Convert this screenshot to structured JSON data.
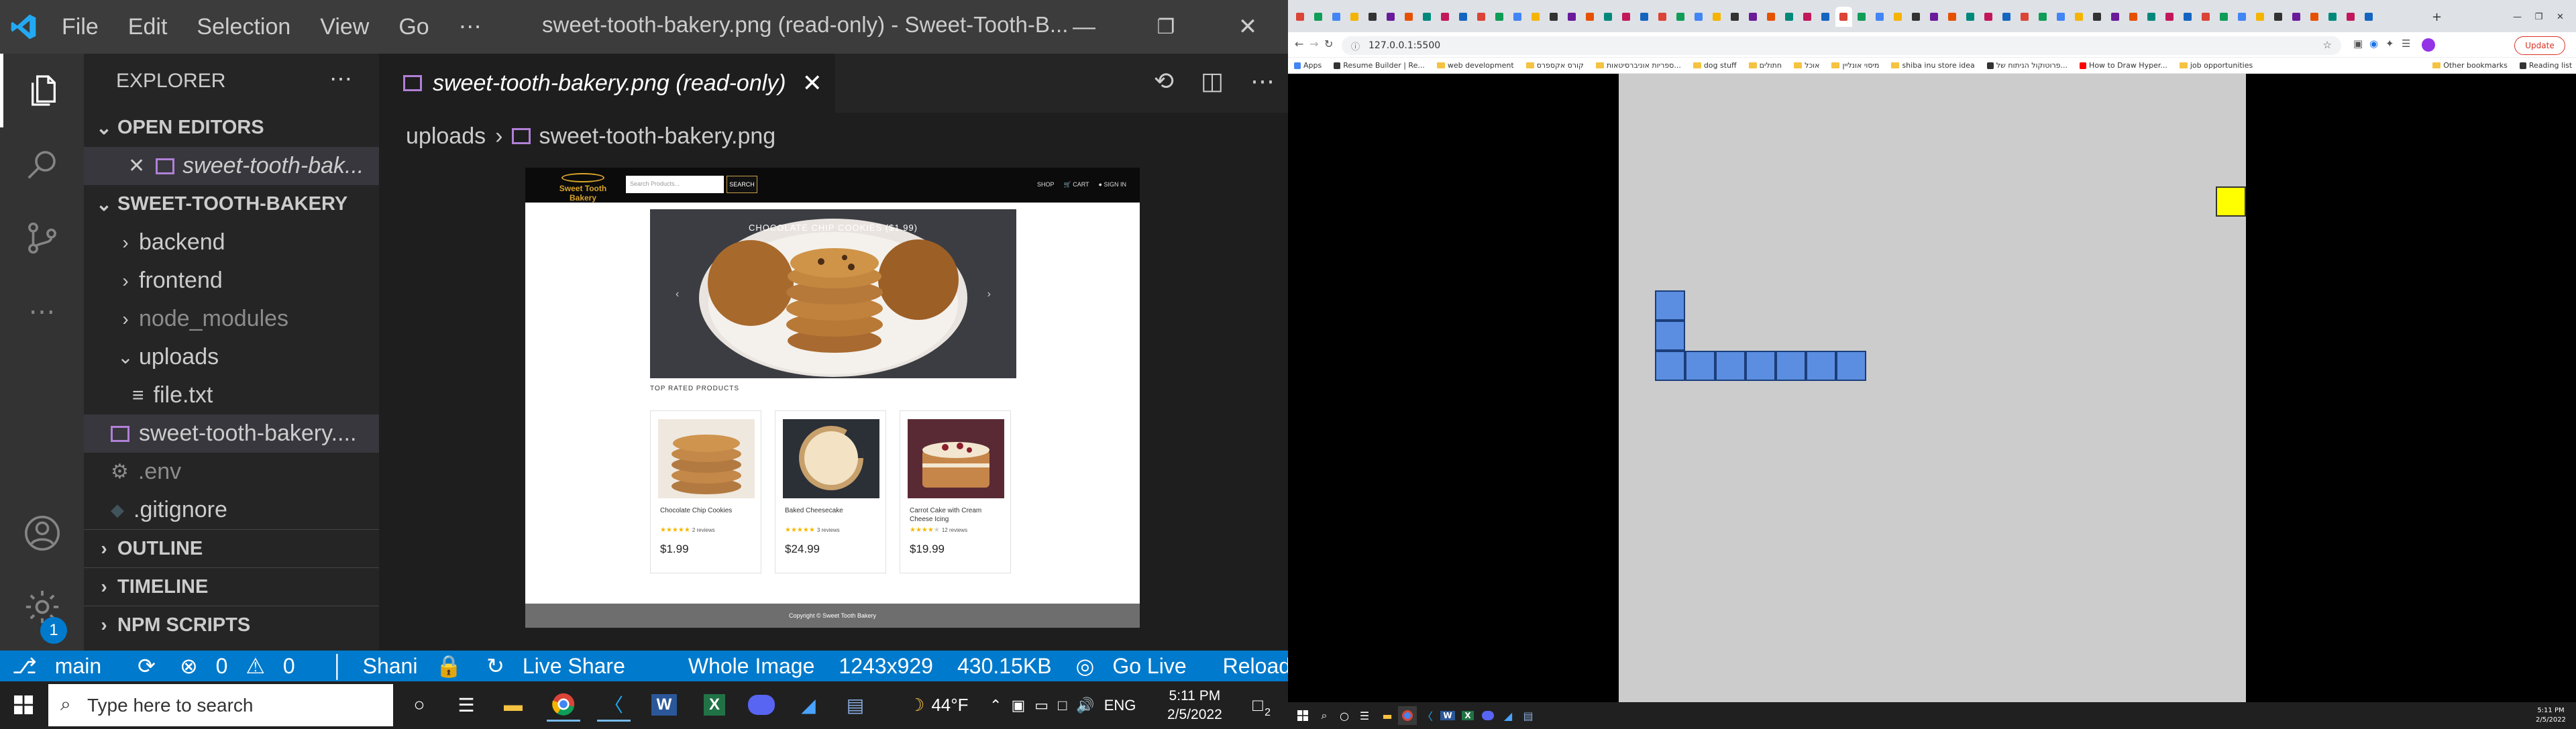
{
  "vscode": {
    "menu": [
      "File",
      "Edit",
      "Selection",
      "View",
      "Go",
      "⋯"
    ],
    "window_title": "sweet-tooth-bakery.png (read-only) - Sweet-Tooth-B...",
    "sidebar": {
      "title": "EXPLORER",
      "open_editors_label": "OPEN EDITORS",
      "open_editor_item": "sweet-tooth-bak...",
      "project_label": "SWEET-TOOTH-BAKERY",
      "items": [
        {
          "label": "backend",
          "kind": "folder"
        },
        {
          "label": "frontend",
          "kind": "folder"
        },
        {
          "label": "node_modules",
          "kind": "folder"
        },
        {
          "label": "uploads",
          "kind": "folder-open"
        },
        {
          "label": "file.txt",
          "kind": "file"
        },
        {
          "label": "sweet-tooth-bakery....",
          "kind": "image"
        },
        {
          "label": ".env",
          "kind": "gear"
        },
        {
          "label": ".gitignore",
          "kind": "diamond"
        }
      ],
      "outline_label": "OUTLINE",
      "timeline_label": "TIMELINE",
      "npm_label": "NPM SCRIPTS"
    },
    "tab": {
      "label": "sweet-tooth-bakery.png (read-only)"
    },
    "breadcrumb": {
      "folder": "uploads",
      "file": "sweet-tooth-bakery.png"
    },
    "settings_badge": "1",
    "statusbar": {
      "branch": "main",
      "errors": "0",
      "warnings": "0",
      "user": "Shani",
      "live_share": "Live Share",
      "zoom": "Whole Image",
      "dimensions": "1243x929",
      "size": "430.15KB",
      "go_live": "Go Live",
      "reload": "Reload"
    }
  },
  "preview": {
    "logo_text": "Sweet Tooth Bakery",
    "search_placeholder": "Search Products...",
    "search_button": "SEARCH",
    "nav_shop": "SHOP",
    "nav_cart": "CART",
    "nav_signin": "SIGN IN",
    "hero_title": "CHOCOLATE CHIP COOKIES ($1.99)",
    "section_title": "TOP RATED PRODUCTS",
    "products": [
      {
        "name": "Chocolate Chip Cookies",
        "rating": 5,
        "reviews": "2 reviews",
        "price": "$1.99"
      },
      {
        "name": "Baked Cheesecake",
        "rating": 5,
        "reviews": "3 reviews",
        "price": "$24.99"
      },
      {
        "name": "Carrot Cake with Cream Cheese Icing",
        "rating": 4,
        "reviews": "12 reviews",
        "price": "$19.99"
      }
    ],
    "footer": "Copyright © Sweet Tooth Bakery"
  },
  "chrome": {
    "url": "127.0.0.1:5500",
    "update_label": "Update",
    "bookmarks": [
      {
        "label": "Apps",
        "kind": "apps"
      },
      {
        "label": "Resume Builder | Re...",
        "kind": "site"
      },
      {
        "label": "web development",
        "kind": "folder"
      },
      {
        "label": "קורס אקספרס",
        "kind": "folder"
      },
      {
        "label": "ספריות אוניברסיטאות...",
        "kind": "folder"
      },
      {
        "label": "dog stuff",
        "kind": "folder"
      },
      {
        "label": "חתולים",
        "kind": "folder"
      },
      {
        "label": "אוכל",
        "kind": "folder"
      },
      {
        "label": "מיסוי אונליין",
        "kind": "folder"
      },
      {
        "label": "shiba inu store idea",
        "kind": "folder"
      },
      {
        "label": "פרוטוקול הניתוח של...",
        "kind": "site"
      },
      {
        "label": "How to Draw Hyper...",
        "kind": "youtube"
      },
      {
        "label": "job opportunities",
        "kind": "folder"
      },
      {
        "label": "Other bookmarks",
        "kind": "folder"
      },
      {
        "label": "Reading list",
        "kind": "list"
      }
    ]
  },
  "taskbar": {
    "search_placeholder": "Type here to search",
    "weather": "44°F",
    "language": "ENG",
    "time": "5:11 PM",
    "date": "2/5/2022",
    "notification_count": "2"
  },
  "taskbar_right": {
    "time": "5:11 PM",
    "date": "2/5/2022"
  }
}
